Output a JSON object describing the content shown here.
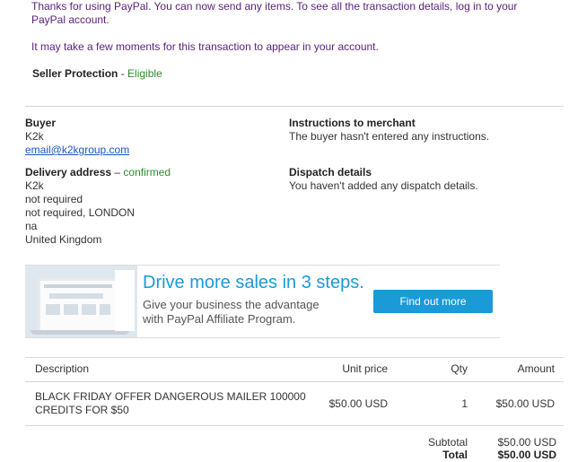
{
  "intro": {
    "line1": "Thanks for using PayPal. You can now send any items. To see all the transaction details, log in to your",
    "line2": "PayPal account.",
    "line3": "It may take a few moments for this transaction to appear in your account."
  },
  "protection": {
    "label": "Seller Protection",
    "separator": " - ",
    "status": "Eligible"
  },
  "buyer": {
    "heading": "Buyer",
    "name": "K2k",
    "email": "email@k2kgroup.com"
  },
  "delivery": {
    "heading": "Delivery address",
    "dash": " – ",
    "status": "confirmed",
    "lines": [
      "K2k",
      "not required",
      "not required, LONDON",
      "na",
      "United Kingdom"
    ]
  },
  "instructions": {
    "heading": "Instructions to merchant",
    "text": "The buyer hasn't entered any instructions."
  },
  "dispatch": {
    "heading": "Dispatch details",
    "text": "You haven't added any dispatch details."
  },
  "banner": {
    "headline": "Drive more sales in 3 steps.",
    "sub1": "Give your business the advantage",
    "sub2": "with PayPal Affiliate Program.",
    "button": "Find out more"
  },
  "table": {
    "headers": {
      "description": "Description",
      "unit_price": "Unit price",
      "qty": "Qty",
      "amount": "Amount"
    },
    "row": {
      "desc1": "BLACK FRIDAY OFFER DANGEROUS MAILER 100000",
      "desc2": "CREDITS FOR $50",
      "unit_price": "$50.00 USD",
      "qty": "1",
      "amount": "$50.00 USD"
    },
    "subtotal_label": "Subtotal",
    "subtotal_value": "$50.00 USD",
    "total_label": "Total",
    "total_value": "$50.00 USD"
  }
}
